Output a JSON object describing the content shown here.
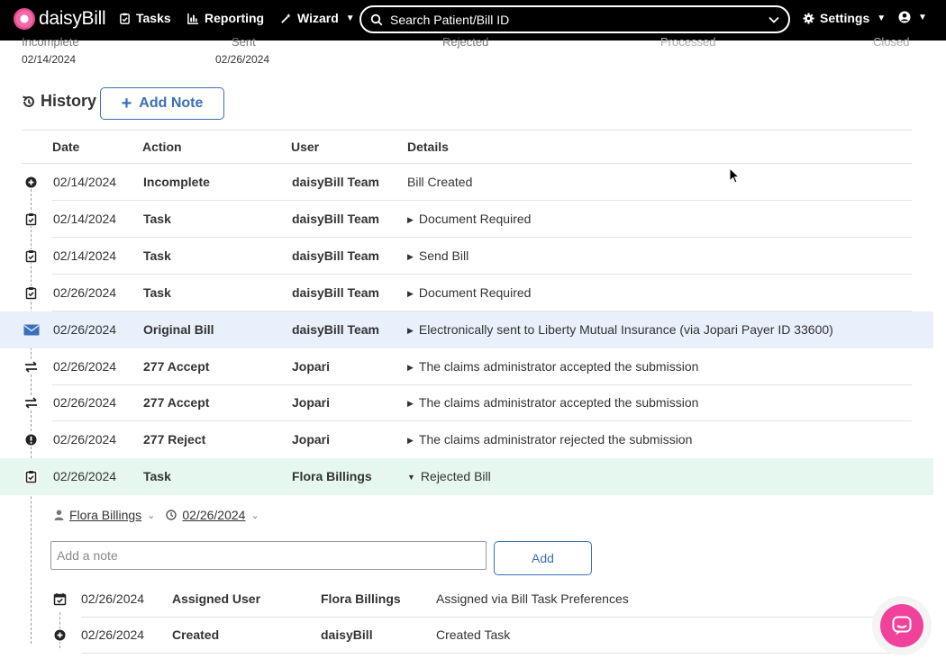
{
  "navbar": {
    "brand": "daisyBill",
    "tasks": "Tasks",
    "reporting": "Reporting",
    "wizard": "Wizard",
    "search_placeholder": "Search Patient/Bill ID",
    "settings": "Settings"
  },
  "status": {
    "items": [
      {
        "name": "Incomplete",
        "date": "02/14/2024"
      },
      {
        "name": "Sent",
        "date": "02/26/2024"
      },
      {
        "name": "Rejected",
        "date": ""
      },
      {
        "name": "Processed",
        "date": ""
      },
      {
        "name": "Closed",
        "date": ""
      }
    ]
  },
  "history": {
    "title": "History",
    "add_note": "Add Note",
    "columns": {
      "date": "Date",
      "action": "Action",
      "user": "User",
      "details": "Details"
    },
    "rows": [
      {
        "icon": "plus-circle-icon",
        "date": "02/14/2024",
        "action": "Incomplete",
        "user": "daisyBill Team",
        "details": "Bill Created",
        "expandable": false
      },
      {
        "icon": "task-clipboard-icon",
        "date": "02/14/2024",
        "action": "Task",
        "user": "daisyBill Team",
        "details": "Document Required",
        "expandable": true
      },
      {
        "icon": "task-clipboard-icon",
        "date": "02/14/2024",
        "action": "Task",
        "user": "daisyBill Team",
        "details": "Send Bill",
        "expandable": true
      },
      {
        "icon": "task-clipboard-icon",
        "date": "02/26/2024",
        "action": "Task",
        "user": "daisyBill Team",
        "details": "Document Required",
        "expandable": true
      },
      {
        "icon": "envelope-icon",
        "date": "02/26/2024",
        "action": "Original Bill",
        "user": "daisyBill Team",
        "details": "Electronically sent to Liberty Mutual Insurance (via Jopari Payer ID 33600)",
        "expandable": true
      },
      {
        "icon": "exchange-icon",
        "date": "02/26/2024",
        "action": "277 Accept",
        "user": "Jopari",
        "details": "The claims administrator accepted the submission",
        "expandable": true
      },
      {
        "icon": "exchange-icon",
        "date": "02/26/2024",
        "action": "277 Accept",
        "user": "Jopari",
        "details": "The claims administrator accepted the submission",
        "expandable": true
      },
      {
        "icon": "exclamation-circle-icon",
        "date": "02/26/2024",
        "action": "277 Reject",
        "user": "Jopari",
        "details": "The claims administrator rejected the submission",
        "expandable": true
      },
      {
        "icon": "task-clipboard-icon",
        "date": "02/26/2024",
        "action": "Task",
        "user": "Flora Billings",
        "details": "Rejected Bill",
        "expandable": true,
        "expanded": true
      }
    ]
  },
  "task_panel": {
    "assignee": "Flora Billings",
    "due_date": "02/26/2024",
    "note_placeholder": "Add a note",
    "add_button": "Add",
    "subrows": [
      {
        "icon": "calendar-check-icon",
        "date": "02/26/2024",
        "action": "Assigned User",
        "user": "Flora Billings",
        "details": "Assigned via Bill Task Preferences"
      },
      {
        "icon": "plus-circle-icon",
        "date": "02/26/2024",
        "action": "Created",
        "user": "daisyBill",
        "details": "Created Task"
      }
    ]
  },
  "colors": {
    "brand_pink": "#f0429a",
    "accent_blue": "#3b6fb6",
    "row_highlight_blue": "#e7f0fb",
    "row_highlight_green": "#e5f7ef"
  }
}
